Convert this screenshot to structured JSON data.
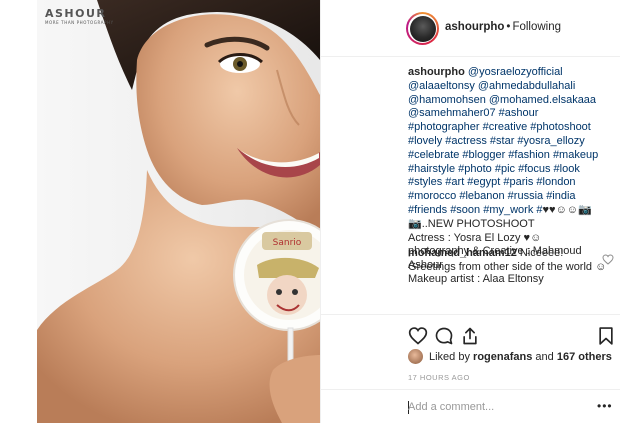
{
  "photo": {
    "watermark_name": "ASHOUR",
    "watermark_sub": "MORE THAN PHOTOGRAPHY"
  },
  "header": {
    "username": "ashourpho",
    "separator": "•",
    "follow_status": "Following"
  },
  "caption": {
    "username": "ashourpho",
    "tags": "@yosraelozyofficial @alaaeltonsy @ahmedabdullahali @hamomohsen @mohamed.elsakaaa @samehmaher07 #ashour #photographer #creative #photoshoot #lovely #actress #star #yosra_ellozy #celebrate #blogger #fashion #makeup #hairstyle #photo #pic #focus #look #styles #art #egypt #paris #london #morocco #lebanon #russia #india #friends #soon #my_work #",
    "emoji_tail": "♥♥☺☺📷📷..NEW PHOTOSHOOT",
    "line_actress": "Actress : Yosra El Lozy ♥☺",
    "line_photography": "photography & Creative : Mahmoud Ashour",
    "line_makeup": "Makeup artist : Alaa Eltonsy"
  },
  "comment": {
    "username": "mohamed_hamam12",
    "text": "Niceeee! Greetings from other side of the world ☺"
  },
  "likes": {
    "prefix": "Liked by",
    "user": "rogenafans",
    "middle": "and",
    "others": "167 others"
  },
  "timestamp": "17 HOURS AGO",
  "comment_box": {
    "placeholder": "Add a comment...",
    "more": "•••"
  },
  "colors": {
    "text": "#262626",
    "link": "#003569",
    "muted": "#999999",
    "border": "#efefef"
  },
  "icons": {
    "like": "heart-icon",
    "comment": "speech-bubble-icon",
    "share": "share-arrow-icon",
    "save": "bookmark-icon",
    "comment_like": "small-heart-icon",
    "options": "ellipsis-icon"
  }
}
